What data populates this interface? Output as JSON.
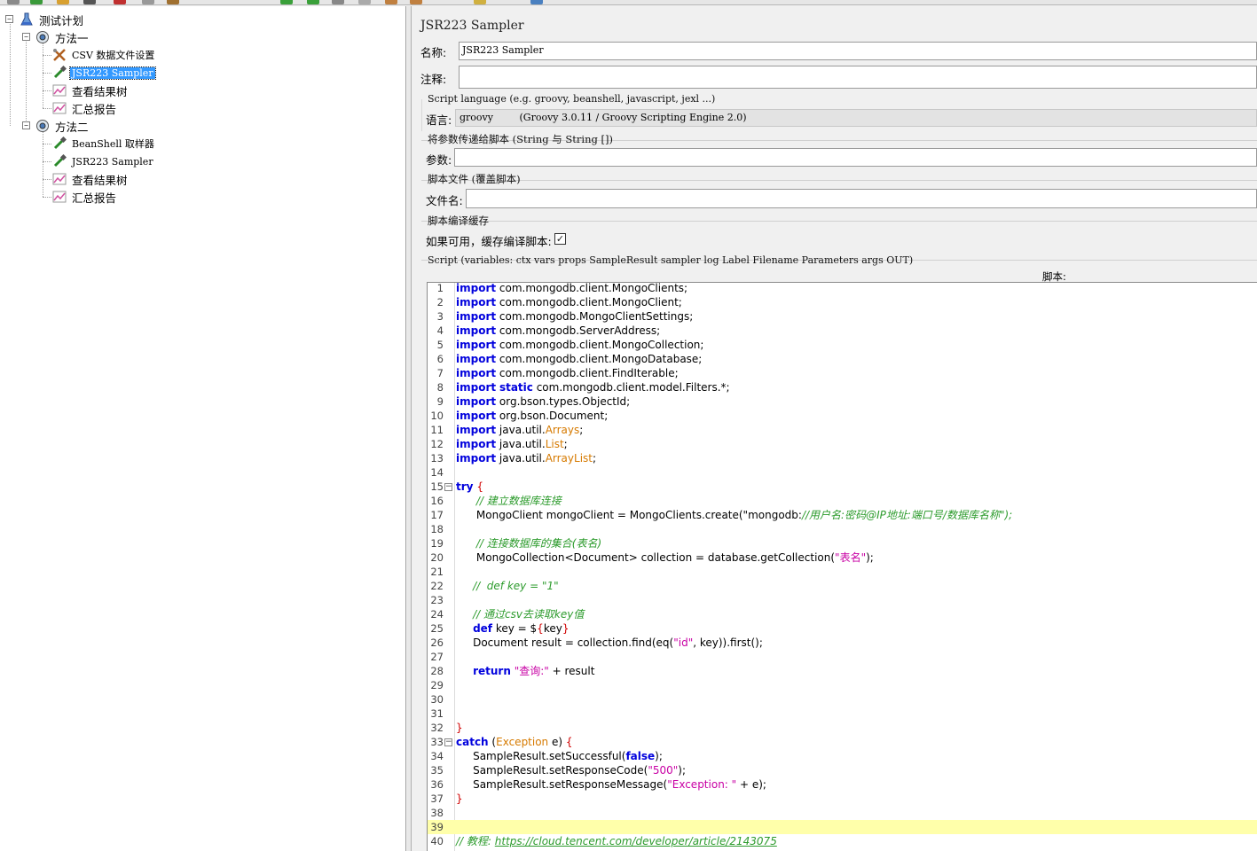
{
  "tree": {
    "root": {
      "label": "测试计划"
    },
    "group1": {
      "label": "方法一",
      "children": [
        "CSV 数据文件设置",
        "JSR223 Sampler",
        "查看结果树",
        "汇总报告"
      ]
    },
    "group2": {
      "label": "方法二",
      "children": [
        "BeanShell 取样器",
        "JSR223 Sampler",
        "查看结果树",
        "汇总报告"
      ]
    }
  },
  "sampler": {
    "title": "JSR223 Sampler",
    "name_label": "名称:",
    "name_value": "JSR223 Sampler",
    "comment_label": "注释:",
    "comment_value": "",
    "script_language_title": "Script language (e.g. groovy, beanshell, javascript, jexl ...)",
    "language_label": "语言:",
    "language_value": "groovy",
    "language_engine": "(Groovy 3.0.11 / Groovy Scripting Engine 2.0)",
    "params_title": "将参数传递给脚本 (String 与 String [])",
    "params_label": "参数:",
    "params_value": "",
    "script_file_title": "脚本文件 (覆盖脚本)",
    "filename_label": "文件名:",
    "filename_value": "",
    "cache_title": "脚本编译缓存",
    "cache_label": "如果可用，缓存编译脚本:",
    "cache_checked": true,
    "script_title": "Script (variables: ctx vars props SampleResult sampler log Label Filename Parameters args OUT)",
    "script_label": "脚本:"
  },
  "editor": {
    "current_line": 39,
    "lines": [
      "import com.mongodb.client.MongoClients;",
      "import com.mongodb.client.MongoClient;",
      "import com.mongodb.MongoClientSettings;",
      "import com.mongodb.ServerAddress;",
      "import com.mongodb.client.MongoCollection;",
      "import com.mongodb.client.MongoDatabase;",
      "import com.mongodb.client.FindIterable;",
      "import static com.mongodb.client.model.Filters.*;",
      "import org.bson.types.ObjectId;",
      "import org.bson.Document;",
      "import java.util.Arrays;",
      "import java.util.List;",
      "import java.util.ArrayList;",
      "",
      "try {",
      "      // 建立数据库连接",
      "      MongoClient mongoClient = MongoClients.create(\"mongodb://用户名:密码@IP地址:端口号/数据库名称\");",
      "",
      "      // 连接数据库的集合(表名)",
      "      MongoCollection<Document> collection = database.getCollection(\"表名\");",
      "",
      "     //  def key = \"1\"",
      "",
      "     // 通过csv去读取key值",
      "     def key = ${key}",
      "     Document result = collection.find(eq(\"id\", key)).first();",
      "",
      "     return \"查询:\" + result",
      "",
      "",
      "",
      "}",
      "catch (Exception e) {",
      "     SampleResult.setSuccessful(false);",
      "     SampleResult.setResponseCode(\"500\");",
      "     SampleResult.setResponseMessage(\"Exception: \" + e);",
      "}",
      "",
      "",
      "// 教程: https://cloud.tencent.com/developer/article/2143075"
    ]
  }
}
